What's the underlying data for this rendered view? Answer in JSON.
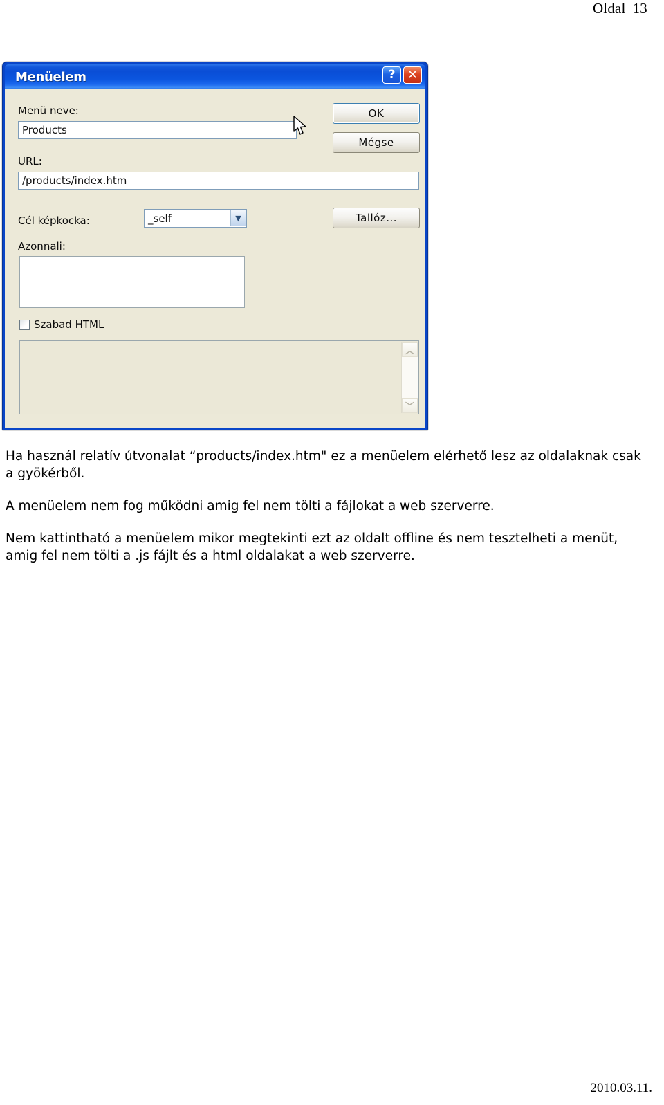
{
  "page": {
    "header_label": "Oldal",
    "header_number": "13",
    "footer_date": "2010.03.11."
  },
  "dialog": {
    "title": "Menüelem",
    "titlebar_buttons": [
      {
        "name": "help-button",
        "glyph": "?"
      },
      {
        "name": "close-button",
        "glyph": "✕"
      }
    ],
    "fields": {
      "menu_name_label": "Menü neve:",
      "menu_name_value": "Products",
      "url_label": "URL:",
      "url_value": "/products/index.htm",
      "target_frame_label": "Cél képkocka:",
      "target_frame_value": "_self",
      "target_frame_options": [
        "_self"
      ],
      "immediate_label": "Azonnali:",
      "immediate_value": "",
      "free_html_label": "Szabad HTML",
      "free_html_checked": false,
      "html_source_value": ""
    },
    "buttons": {
      "ok": "OK",
      "cancel": "Mégse",
      "browse": "Tallóz..."
    },
    "colors": {
      "titlebar_blue": "#0a4ed6",
      "face": "#ece9d8",
      "close_red": "#dd4422",
      "field_border": "#7f9db9"
    }
  },
  "text": {
    "paragraphs": [
      "Ha használ relatív útvonalat “products/index.htm\" ez a menüelem elérhető lesz az oldalaknak csak a gyökérből.",
      "A menüelem nem fog működni amig fel nem tölti a fájlokat a web szerverre.",
      "Nem kattintható a menüelem mikor megtekinti ezt az oldalt offline és nem tesztelheti a menüt, amig fel nem tölti a .js fájlt és a html oldalakat a web szerverre."
    ]
  }
}
